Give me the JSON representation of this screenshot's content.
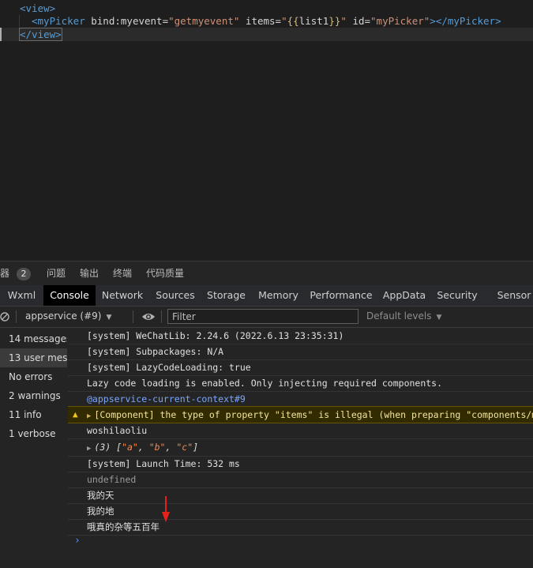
{
  "editor": {
    "line1": {
      "open": "<view>"
    },
    "line2": {
      "tag_open": "<myPicker",
      "attr1": " bind:myevent=",
      "val1": "\"getmyevent\"",
      "attr2": " items=",
      "val2_q1": "\"",
      "val2_b1": "{{",
      "val2_mid": "list1",
      "val2_b2": "}}",
      "val2_q2": "\"",
      "attr3": " id=",
      "val3": "\"myPicker\"",
      "tag_end": ">",
      "tag_close": "</myPicker>"
    },
    "line3": {
      "close": "</view>"
    }
  },
  "panel_tabs": [
    {
      "label": "器"
    },
    {
      "label": "问题"
    },
    {
      "label": "输出"
    },
    {
      "label": "终端"
    },
    {
      "label": "代码质量"
    }
  ],
  "panel_badge": "2",
  "devtools_tabs": [
    "Wxml",
    "Console",
    "Network",
    "Sources",
    "Storage",
    "Memory",
    "Performance",
    "AppData",
    "Security",
    "Sensor"
  ],
  "toolbar": {
    "context": "appservice (#9)",
    "filter_placeholder": "Filter",
    "levels": "Default levels"
  },
  "sidebar": [
    {
      "label": "14 messages"
    },
    {
      "label": "13 user mes..."
    },
    {
      "label": "No errors"
    },
    {
      "label": "2 warnings"
    },
    {
      "label": "11 info"
    },
    {
      "label": "1 verbose"
    }
  ],
  "console": {
    "m1": "[system] WeChatLib: 2.24.6 (2022.6.13 23:35:31)",
    "m2": "[system] Subpackages: N/A",
    "m3": "[system] LazyCodeLoading: true",
    "m4": "Lazy code loading is enabled. Only injecting required components.",
    "m5": "@appservice-current-context#9",
    "m6": "[Component] the type of property \"items\" is illegal (when preparing \"components/myPi",
    "m7": "woshilaoliu",
    "m8": {
      "count": "(3) ",
      "open": "[",
      "a": "\"a\"",
      "b": "\"b\"",
      "c": "\"c\"",
      "sep": ", ",
      "close": "]"
    },
    "m9": "[system] Launch Time: 532 ms",
    "m10": "undefined",
    "m11": "我的天",
    "m12": "我的地",
    "m13": "哦真的杂等五百年",
    "prompt": "›"
  },
  "colors": {
    "annotation_arrow": "#e8201a",
    "warning": "#f5c518"
  }
}
